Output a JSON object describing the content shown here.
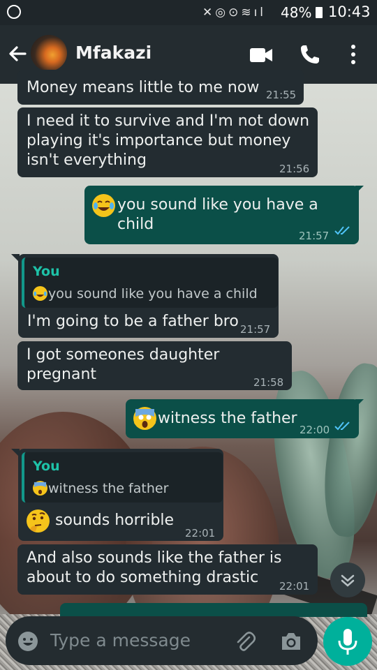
{
  "status_bar": {
    "battery": "48%",
    "time": "10:43"
  },
  "header": {
    "contact_name": "Mfakazi"
  },
  "messages": [
    {
      "id": "m1",
      "direction": "in",
      "text": "Money means little to me now",
      "time": "21:55"
    },
    {
      "id": "m2",
      "direction": "in",
      "text_lines": [
        "I need it to survive and I'm not down",
        "playing it's importance but money",
        "isn't everything"
      ],
      "time": "21:56"
    },
    {
      "id": "m3",
      "direction": "out",
      "text": "you sound like you have a child",
      "time": "21:57",
      "emoji": "tears-of-joy"
    },
    {
      "id": "m4",
      "direction": "in",
      "quote": {
        "author": "You",
        "text": "you sound like you have a child"
      },
      "text": "I'm going to be a father bro",
      "time": "21:57"
    },
    {
      "id": "m5",
      "direction": "in",
      "text": "I got someones daughter pregnant",
      "time": "21:58"
    },
    {
      "id": "m6",
      "direction": "out",
      "text": "witness the father",
      "time": "22:00",
      "emoji": "screaming-face"
    },
    {
      "id": "m7",
      "direction": "in",
      "quote": {
        "author": "You",
        "text": "witness the father"
      },
      "text": "sounds horrible",
      "time": "22:01",
      "emoji": "thinking-face"
    },
    {
      "id": "m8",
      "direction": "in",
      "text_lines": [
        "And also sounds like the father is",
        "about to do something drastic"
      ],
      "time": "22:01"
    }
  ],
  "composer": {
    "placeholder": "Type a message"
  },
  "colors": {
    "accent": "#00b09b",
    "incoming_bubble": "#232c31",
    "outgoing_bubble": "#0b4f48",
    "read_ticks": "#4fc3f7"
  },
  "icons": [
    "whatsapp-status-icon",
    "back-arrow-icon",
    "video-call-icon",
    "phone-call-icon",
    "more-menu-icon",
    "emoji-icon",
    "attach-icon",
    "camera-icon",
    "microphone-icon",
    "chevron-down-icon"
  ]
}
